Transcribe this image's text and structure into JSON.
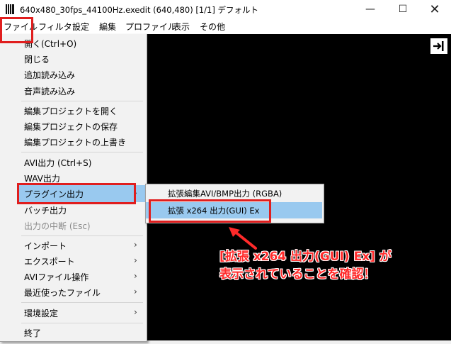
{
  "window": {
    "title": "640x480_30fps_44100Hz.exedit (640,480)  [1/1]  デフォルト",
    "minimize_glyph": "—",
    "maximize_glyph": "☐",
    "close_glyph": "✕"
  },
  "menubar": {
    "items": [
      "ファイル",
      "フィルタ",
      "設定",
      "編集",
      "プロファイル",
      "表示",
      "その他"
    ]
  },
  "file_menu": {
    "items": [
      {
        "label": "開く(Ctrl+O)"
      },
      {
        "label": "閉じる"
      },
      {
        "label": "追加読み込み"
      },
      {
        "label": "音声読み込み"
      },
      {
        "label": "編集プロジェクトを開く"
      },
      {
        "label": "編集プロジェクトの保存"
      },
      {
        "label": "編集プロジェクトの上書き"
      },
      {
        "label": "AVI出力 (Ctrl+S)"
      },
      {
        "label": "WAV出力"
      },
      {
        "label": "プラグイン出力"
      },
      {
        "label": "バッチ出力"
      },
      {
        "label": "出力の中断 (Esc)"
      },
      {
        "label": "インポート"
      },
      {
        "label": "エクスポート"
      },
      {
        "label": "AVIファイル操作"
      },
      {
        "label": "最近使ったファイル"
      },
      {
        "label": "環境設定"
      },
      {
        "label": "終了"
      }
    ],
    "submenu_arrow": "›"
  },
  "plugin_submenu": {
    "items": [
      {
        "label": "拡張編集AVI/BMP出力 (RGBA)"
      },
      {
        "label": "拡張 x264 出力(GUI) Ex"
      }
    ]
  },
  "annotation": {
    "line1": "[拡張 x264 出力(GUI) Ex] が",
    "line2": "表示されていることを確認！"
  },
  "colors": {
    "highlight": "#99c9ef",
    "red": "#e01e1e",
    "canvas": "#000000"
  },
  "icons": {
    "dock": "dock-right-icon",
    "app": "film-icon"
  }
}
